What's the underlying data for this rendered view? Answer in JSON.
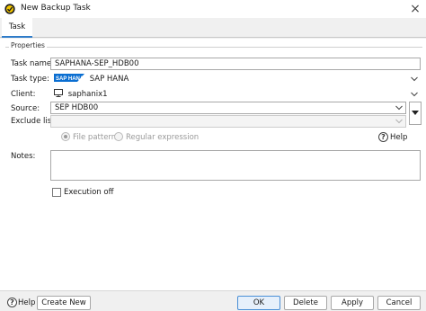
{
  "window": {
    "title": "New Backup Task",
    "close_glyph": "×"
  },
  "tabs": [
    {
      "label": "Task",
      "active": true
    }
  ],
  "properties": {
    "section_title": "Properties",
    "task_name": {
      "label": "Task name:",
      "value": "SAPHANA-SEP_HDB00"
    },
    "task_type": {
      "label": "Task type:",
      "value": "SAP HANA",
      "logo_text": "SAP HANA"
    },
    "client": {
      "label": "Client:",
      "value": "saphanix1"
    },
    "source": {
      "label": "Source:",
      "value": "SEP HDB00"
    },
    "exclude_list": {
      "label": "Exclude list:",
      "value": ""
    },
    "pattern": {
      "file_pattern_label": "File pattern",
      "regex_label": "Regular expression",
      "selected": "file_pattern"
    },
    "help_inline": "Help",
    "notes": {
      "label": "Notes:",
      "value": ""
    },
    "execution_off": {
      "label": "Execution off",
      "checked": false
    }
  },
  "footer": {
    "help": "Help",
    "create_new": "Create New",
    "ok": "OK",
    "delete": "Delete",
    "apply": "Apply",
    "cancel": "Cancel"
  },
  "colors": {
    "accent": "#2f7cc9",
    "hana_blue": "#0a6ed1",
    "app_icon_yellow": "#f2c500"
  }
}
